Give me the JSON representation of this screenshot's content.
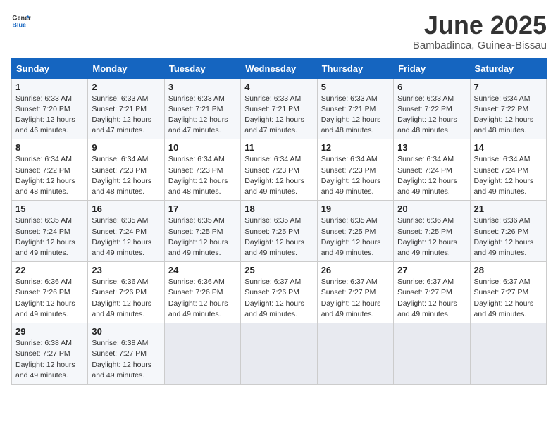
{
  "logo": {
    "general": "General",
    "blue": "Blue"
  },
  "title": "June 2025",
  "subtitle": "Bambadinca, Guinea-Bissau",
  "headers": [
    "Sunday",
    "Monday",
    "Tuesday",
    "Wednesday",
    "Thursday",
    "Friday",
    "Saturday"
  ],
  "weeks": [
    [
      {
        "day": "1",
        "sunrise": "Sunrise: 6:33 AM",
        "sunset": "Sunset: 7:20 PM",
        "daylight": "Daylight: 12 hours and 46 minutes."
      },
      {
        "day": "2",
        "sunrise": "Sunrise: 6:33 AM",
        "sunset": "Sunset: 7:21 PM",
        "daylight": "Daylight: 12 hours and 47 minutes."
      },
      {
        "day": "3",
        "sunrise": "Sunrise: 6:33 AM",
        "sunset": "Sunset: 7:21 PM",
        "daylight": "Daylight: 12 hours and 47 minutes."
      },
      {
        "day": "4",
        "sunrise": "Sunrise: 6:33 AM",
        "sunset": "Sunset: 7:21 PM",
        "daylight": "Daylight: 12 hours and 47 minutes."
      },
      {
        "day": "5",
        "sunrise": "Sunrise: 6:33 AM",
        "sunset": "Sunset: 7:21 PM",
        "daylight": "Daylight: 12 hours and 48 minutes."
      },
      {
        "day": "6",
        "sunrise": "Sunrise: 6:33 AM",
        "sunset": "Sunset: 7:22 PM",
        "daylight": "Daylight: 12 hours and 48 minutes."
      },
      {
        "day": "7",
        "sunrise": "Sunrise: 6:34 AM",
        "sunset": "Sunset: 7:22 PM",
        "daylight": "Daylight: 12 hours and 48 minutes."
      }
    ],
    [
      {
        "day": "8",
        "sunrise": "Sunrise: 6:34 AM",
        "sunset": "Sunset: 7:22 PM",
        "daylight": "Daylight: 12 hours and 48 minutes."
      },
      {
        "day": "9",
        "sunrise": "Sunrise: 6:34 AM",
        "sunset": "Sunset: 7:23 PM",
        "daylight": "Daylight: 12 hours and 48 minutes."
      },
      {
        "day": "10",
        "sunrise": "Sunrise: 6:34 AM",
        "sunset": "Sunset: 7:23 PM",
        "daylight": "Daylight: 12 hours and 48 minutes."
      },
      {
        "day": "11",
        "sunrise": "Sunrise: 6:34 AM",
        "sunset": "Sunset: 7:23 PM",
        "daylight": "Daylight: 12 hours and 49 minutes."
      },
      {
        "day": "12",
        "sunrise": "Sunrise: 6:34 AM",
        "sunset": "Sunset: 7:23 PM",
        "daylight": "Daylight: 12 hours and 49 minutes."
      },
      {
        "day": "13",
        "sunrise": "Sunrise: 6:34 AM",
        "sunset": "Sunset: 7:24 PM",
        "daylight": "Daylight: 12 hours and 49 minutes."
      },
      {
        "day": "14",
        "sunrise": "Sunrise: 6:34 AM",
        "sunset": "Sunset: 7:24 PM",
        "daylight": "Daylight: 12 hours and 49 minutes."
      }
    ],
    [
      {
        "day": "15",
        "sunrise": "Sunrise: 6:35 AM",
        "sunset": "Sunset: 7:24 PM",
        "daylight": "Daylight: 12 hours and 49 minutes."
      },
      {
        "day": "16",
        "sunrise": "Sunrise: 6:35 AM",
        "sunset": "Sunset: 7:24 PM",
        "daylight": "Daylight: 12 hours and 49 minutes."
      },
      {
        "day": "17",
        "sunrise": "Sunrise: 6:35 AM",
        "sunset": "Sunset: 7:25 PM",
        "daylight": "Daylight: 12 hours and 49 minutes."
      },
      {
        "day": "18",
        "sunrise": "Sunrise: 6:35 AM",
        "sunset": "Sunset: 7:25 PM",
        "daylight": "Daylight: 12 hours and 49 minutes."
      },
      {
        "day": "19",
        "sunrise": "Sunrise: 6:35 AM",
        "sunset": "Sunset: 7:25 PM",
        "daylight": "Daylight: 12 hours and 49 minutes."
      },
      {
        "day": "20",
        "sunrise": "Sunrise: 6:36 AM",
        "sunset": "Sunset: 7:25 PM",
        "daylight": "Daylight: 12 hours and 49 minutes."
      },
      {
        "day": "21",
        "sunrise": "Sunrise: 6:36 AM",
        "sunset": "Sunset: 7:26 PM",
        "daylight": "Daylight: 12 hours and 49 minutes."
      }
    ],
    [
      {
        "day": "22",
        "sunrise": "Sunrise: 6:36 AM",
        "sunset": "Sunset: 7:26 PM",
        "daylight": "Daylight: 12 hours and 49 minutes."
      },
      {
        "day": "23",
        "sunrise": "Sunrise: 6:36 AM",
        "sunset": "Sunset: 7:26 PM",
        "daylight": "Daylight: 12 hours and 49 minutes."
      },
      {
        "day": "24",
        "sunrise": "Sunrise: 6:36 AM",
        "sunset": "Sunset: 7:26 PM",
        "daylight": "Daylight: 12 hours and 49 minutes."
      },
      {
        "day": "25",
        "sunrise": "Sunrise: 6:37 AM",
        "sunset": "Sunset: 7:26 PM",
        "daylight": "Daylight: 12 hours and 49 minutes."
      },
      {
        "day": "26",
        "sunrise": "Sunrise: 6:37 AM",
        "sunset": "Sunset: 7:27 PM",
        "daylight": "Daylight: 12 hours and 49 minutes."
      },
      {
        "day": "27",
        "sunrise": "Sunrise: 6:37 AM",
        "sunset": "Sunset: 7:27 PM",
        "daylight": "Daylight: 12 hours and 49 minutes."
      },
      {
        "day": "28",
        "sunrise": "Sunrise: 6:37 AM",
        "sunset": "Sunset: 7:27 PM",
        "daylight": "Daylight: 12 hours and 49 minutes."
      }
    ],
    [
      {
        "day": "29",
        "sunrise": "Sunrise: 6:38 AM",
        "sunset": "Sunset: 7:27 PM",
        "daylight": "Daylight: 12 hours and 49 minutes."
      },
      {
        "day": "30",
        "sunrise": "Sunrise: 6:38 AM",
        "sunset": "Sunset: 7:27 PM",
        "daylight": "Daylight: 12 hours and 49 minutes."
      },
      null,
      null,
      null,
      null,
      null
    ]
  ]
}
